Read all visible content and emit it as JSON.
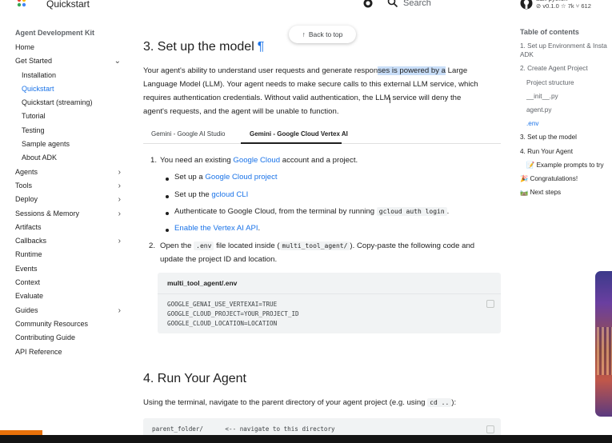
{
  "header": {
    "title": "Quickstart",
    "search_placeholder": "Search",
    "repo_name": "adk-python",
    "repo_version": "v0.1.0",
    "repo_stars": "7k",
    "repo_forks": "612"
  },
  "sidebar": {
    "heading": "Agent Development Kit",
    "items": [
      {
        "label": "Home",
        "level": 0,
        "chevron": ""
      },
      {
        "label": "Get Started",
        "level": 0,
        "chevron": "expanded"
      },
      {
        "label": "Installation",
        "level": 1,
        "chevron": ""
      },
      {
        "label": "Quickstart",
        "level": 1,
        "chevron": "",
        "active": true
      },
      {
        "label": "Quickstart (streaming)",
        "level": 1,
        "chevron": ""
      },
      {
        "label": "Tutorial",
        "level": 1,
        "chevron": ""
      },
      {
        "label": "Testing",
        "level": 1,
        "chevron": ""
      },
      {
        "label": "Sample agents",
        "level": 1,
        "chevron": ""
      },
      {
        "label": "About ADK",
        "level": 1,
        "chevron": ""
      },
      {
        "label": "Agents",
        "level": 0,
        "chevron": "collapsed"
      },
      {
        "label": "Tools",
        "level": 0,
        "chevron": "collapsed"
      },
      {
        "label": "Deploy",
        "level": 0,
        "chevron": "collapsed"
      },
      {
        "label": "Sessions & Memory",
        "level": 0,
        "chevron": "collapsed"
      },
      {
        "label": "Artifacts",
        "level": 0,
        "chevron": ""
      },
      {
        "label": "Callbacks",
        "level": 0,
        "chevron": "collapsed"
      },
      {
        "label": "Runtime",
        "level": 0,
        "chevron": ""
      },
      {
        "label": "Events",
        "level": 0,
        "chevron": ""
      },
      {
        "label": "Context",
        "level": 0,
        "chevron": ""
      },
      {
        "label": "Evaluate",
        "level": 0,
        "chevron": ""
      },
      {
        "label": "Guides",
        "level": 0,
        "chevron": "collapsed"
      },
      {
        "label": "Community Resources",
        "level": 0,
        "chevron": ""
      },
      {
        "label": "Contributing Guide",
        "level": 0,
        "chevron": ""
      },
      {
        "label": "API Reference",
        "level": 0,
        "chevron": ""
      }
    ]
  },
  "back_to_top": "Back to top",
  "main": {
    "section3_title": "3. Set up the model",
    "anchor_symbol": "¶",
    "para_lines": [
      {
        "pre": "Your agent's ability to understand user requests and generate respon",
        "hl": "ses is powered by a",
        "post": " Large"
      },
      {
        "pre": "Language Model (LLM). Your agent needs to make secure calls to this external LLM service, which",
        "hl": "",
        "post": ""
      },
      {
        "pre": "requires authentication credentials. Without valid authentication, the LLM service will deny the",
        "hl": "",
        "post": ""
      },
      {
        "pre": "agent's requests, and the agent will be unable to function.",
        "hl": "",
        "post": ""
      }
    ],
    "tabs": [
      "Gemini - Google AI Studio",
      "Gemini - Google Cloud Vertex AI"
    ],
    "step1": {
      "num": "1.",
      "pre": "You need an existing ",
      "link": "Google Cloud",
      "post": " account and a project."
    },
    "bullets": [
      {
        "pre": "Set up a ",
        "link": "Google Cloud project",
        "post": "",
        "code": "",
        "post2": ""
      },
      {
        "pre": "Set up the ",
        "link": "gcloud CLI",
        "post": "",
        "code": "",
        "post2": ""
      },
      {
        "pre": "Authenticate to Google Cloud, from the terminal by running ",
        "link": "",
        "post": "",
        "code": "gcloud auth login",
        "post2": "."
      },
      {
        "pre": "",
        "link": "Enable the Vertex AI API",
        "post": ".",
        "code": "",
        "post2": ""
      }
    ],
    "step2": {
      "num": "2.",
      "a": "Open the ",
      "code1": ".env",
      "b": " file located inside (",
      "code2": "multi_tool_agent/",
      "c": "). Copy-paste the following code and",
      "line2": "update the project ID and location."
    },
    "codeblock": {
      "title": "multi_tool_agent/.env",
      "lines": [
        "GOOGLE_GENAI_USE_VERTEXAI=TRUE",
        "GOOGLE_CLOUD_PROJECT=YOUR_PROJECT_ID",
        "GOOGLE_CLOUD_LOCATION=LOCATION"
      ]
    },
    "section4_title": "4. Run Your Agent",
    "section4_para": {
      "pre": "Using the terminal, navigate to the parent directory of your agent project (e.g. using ",
      "code": "cd ..",
      "post": "):"
    },
    "codeblock2_line": "parent_folder/      <-- navigate to this directory"
  },
  "toc": {
    "heading": "Table of contents",
    "items": [
      {
        "label": "1. Set up Environment & Insta",
        "level": 0,
        "style": ""
      },
      {
        "label": "ADK",
        "level": 0,
        "style": "cont"
      },
      {
        "label": "2. Create Agent Project",
        "level": 0,
        "style": ""
      },
      {
        "label": "Project structure",
        "level": 1,
        "style": ""
      },
      {
        "label": "__init__.py",
        "level": 1,
        "style": ""
      },
      {
        "label": "agent.py",
        "level": 1,
        "style": ""
      },
      {
        "label": ".env",
        "level": 1,
        "style": "active"
      },
      {
        "label": "3. Set up the model",
        "level": 0,
        "style": "dark"
      },
      {
        "label": "4. Run Your Agent",
        "level": 0,
        "style": "dark"
      },
      {
        "label": "📝 Example prompts to try",
        "level": 1,
        "style": "dark"
      },
      {
        "label": "🎉 Congratulations!",
        "level": 0,
        "style": "dark"
      },
      {
        "label": "🛤️ Next steps",
        "level": 0,
        "style": "dark"
      }
    ]
  },
  "colors": {
    "accent": "#1a73e8",
    "highlight": "#c9def8",
    "code_bg": "#f1f3f4",
    "bottom_accent": "#e8710a"
  }
}
